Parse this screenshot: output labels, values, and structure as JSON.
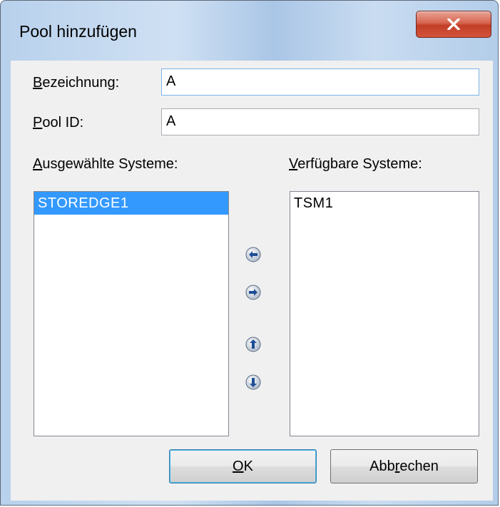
{
  "window": {
    "title": "Pool hinzufügen",
    "close_icon": "close-x-icon"
  },
  "form": {
    "name_label": "Bezeichnung:",
    "name_value": "A",
    "pool_id_label": "Pool ID:",
    "pool_id_value": "A"
  },
  "lists": {
    "selected_label": "Ausgewählte Systeme:",
    "selected_items": [
      "STOREDGE1"
    ],
    "available_label": "Verfügbare Systeme:",
    "available_items": [
      "TSM1"
    ]
  },
  "move_buttons": [
    "arrow-left-icon",
    "arrow-right-icon",
    "arrow-up-icon",
    "arrow-down-icon"
  ],
  "buttons": {
    "ok": "OK",
    "cancel": "Abbrechen"
  },
  "colors": {
    "selection": "#3399ff",
    "close_button": "#c7432d",
    "focus_border": "#7eb4ea"
  }
}
